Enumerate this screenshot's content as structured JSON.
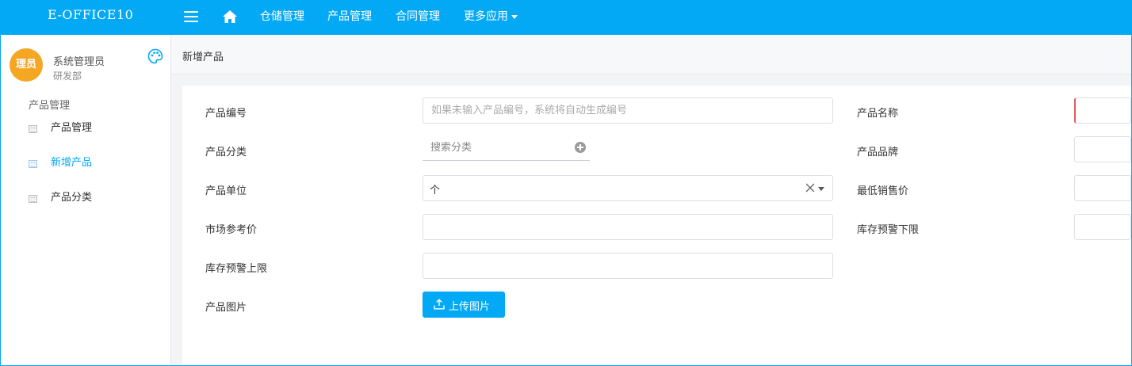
{
  "app": {
    "brand": "E-OFFICE10"
  },
  "topnav": {
    "items": [
      {
        "label": "仓储管理"
      },
      {
        "label": "产品管理"
      },
      {
        "label": "合同管理"
      },
      {
        "label": "更多应用"
      }
    ]
  },
  "user": {
    "avatar_text": "理员",
    "name": "系统管理员",
    "dept": "研发部"
  },
  "sidebar": {
    "group": "产品管理",
    "items": [
      {
        "label": "产品管理",
        "active": false
      },
      {
        "label": "新增产品",
        "active": true
      },
      {
        "label": "产品分类",
        "active": false
      }
    ]
  },
  "page": {
    "title": "新增产品"
  },
  "form": {
    "product_code": {
      "label": "产品编号",
      "value": "",
      "placeholder": "如果未输入产品编号，系统将自动生成编号"
    },
    "product_name": {
      "label": "产品名称",
      "value": "",
      "placeholder": ""
    },
    "category": {
      "label": "产品分类",
      "value": "",
      "placeholder": "搜索分类"
    },
    "brand": {
      "label": "产品品牌",
      "value": "",
      "placeholder": ""
    },
    "unit": {
      "label": "产品单位",
      "value": "个"
    },
    "min_price": {
      "label": "最低销售价",
      "value": "",
      "placeholder": ""
    },
    "market_price": {
      "label": "市场参考价",
      "value": "",
      "placeholder": ""
    },
    "stock_low": {
      "label": "库存预警下限",
      "value": "",
      "placeholder": ""
    },
    "stock_high": {
      "label": "库存预警上限",
      "value": "",
      "placeholder": ""
    },
    "image": {
      "label": "产品图片",
      "button": "上传图片"
    }
  },
  "colors": {
    "primary": "#03a9f4",
    "avatar": "#f5a623",
    "required": "#e65c5c"
  }
}
